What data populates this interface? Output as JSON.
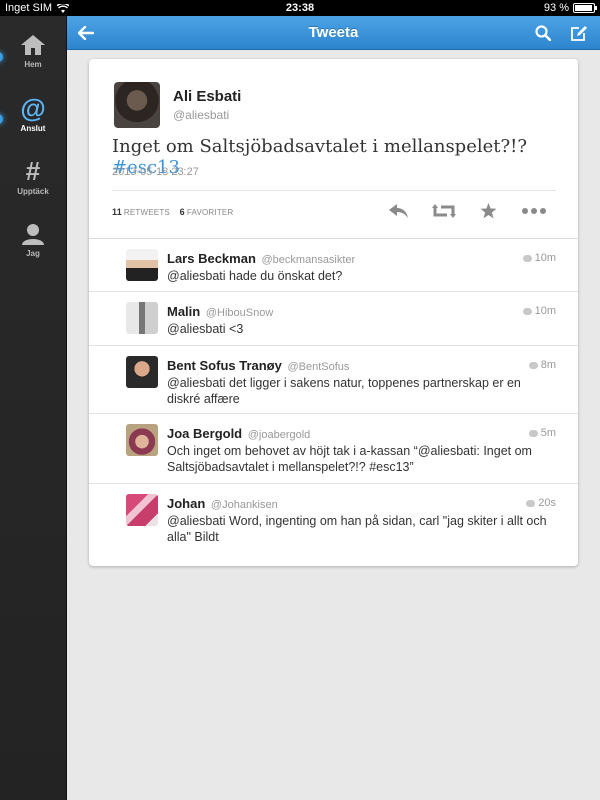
{
  "status_bar": {
    "carrier": "Inget SIM",
    "time": "23:38",
    "battery": "93 %",
    "battery_level": 0.93
  },
  "sidebar": {
    "items": [
      {
        "label": "Hem",
        "icon": "home-icon"
      },
      {
        "label": "Anslut",
        "icon": "at-icon",
        "active": true
      },
      {
        "label": "Upptäck",
        "icon": "hash-icon"
      },
      {
        "label": "Jag",
        "icon": "person-icon"
      }
    ]
  },
  "navbar": {
    "title": "Tweeta",
    "back_icon": "back-arrow-icon",
    "search_icon": "search-icon",
    "compose_icon": "compose-icon"
  },
  "tweet": {
    "author_name": "Ali Esbati",
    "author_handle": "@aliesbati",
    "text": "Inget om Saltsjöbadsavtalet i mellanspelet?!?",
    "hashtag": "#esc13",
    "timestamp": "2013-05-18 23:27",
    "retweets_count": "11",
    "retweets_label": "RETWEETS",
    "favorites_count": "6",
    "favorites_label": "FAVORITER",
    "actions": [
      "reply-icon",
      "retweet-icon",
      "favorite-icon",
      "more-icon"
    ]
  },
  "replies": [
    {
      "name": "Lars Beckman",
      "handle": "@beckmansasikter",
      "time": "10m",
      "text": "@aliesbati hade du önskat det?"
    },
    {
      "name": "Malin",
      "handle": "@HibouSnow",
      "time": "10m",
      "text": "@aliesbati <3"
    },
    {
      "name": "Bent Sofus Tranøy",
      "handle": "@BentSofus",
      "time": "8m",
      "text": "@aliesbati det ligger i sakens natur, toppenes partnerskap er en diskré affære"
    },
    {
      "name": "Joa Bergold",
      "handle": "@joabergold",
      "time": "5m",
      "text": "Och inget om behovet av höjt tak i a-kassan “@aliesbati: Inget om Saltsjöbadsavtalet i mellanspelet?!? #esc13”"
    },
    {
      "name": "Johan",
      "handle": "@Johankisen",
      "time": "20s",
      "text": "@aliesbati Word, ingenting om han på sidan, carl \"jag skiter i allt och alla\" Bildt"
    }
  ],
  "colors": {
    "accent": "#2d85cf",
    "link": "#3b94d9",
    "sidebar_active": "#5bb5f5"
  }
}
